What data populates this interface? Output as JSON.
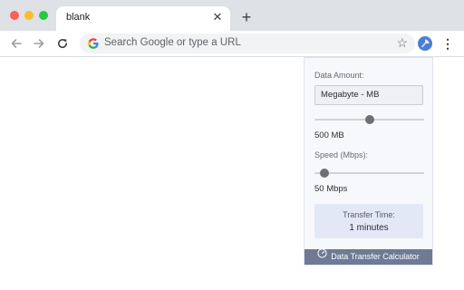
{
  "browser": {
    "tab": {
      "title": "blank",
      "close_glyph": "✕"
    },
    "new_tab_glyph": "+",
    "omnibox": {
      "placeholder": "Search Google or type a URL"
    },
    "icons": [
      "back-arrow-icon",
      "forward-arrow-icon",
      "reload-icon",
      "google-g-icon",
      "bookmark-star-icon",
      "extension-icon",
      "menu-icon"
    ],
    "colors": {
      "tabstrip": "#dee1e6",
      "omnibox": "#f1f3f4"
    }
  },
  "popup": {
    "data_amount_label": "Data Amount:",
    "unit_selected": "Megabyte - MB",
    "data_slider_fraction": 0.5,
    "data_value": "500 MB",
    "speed_label": "Speed (Mbps):",
    "speed_slider_fraction": 0.09,
    "speed_value": "50 Mbps",
    "result_label": "Transfer Time:",
    "result_value": "1 minutes",
    "footer_title": "Data Transfer Calculator",
    "colors": {
      "panel": "#f7f8fc",
      "result_bg": "#e3e8f6",
      "footer_bg": "#6f7a94",
      "thumb": "#6d6f74"
    }
  }
}
